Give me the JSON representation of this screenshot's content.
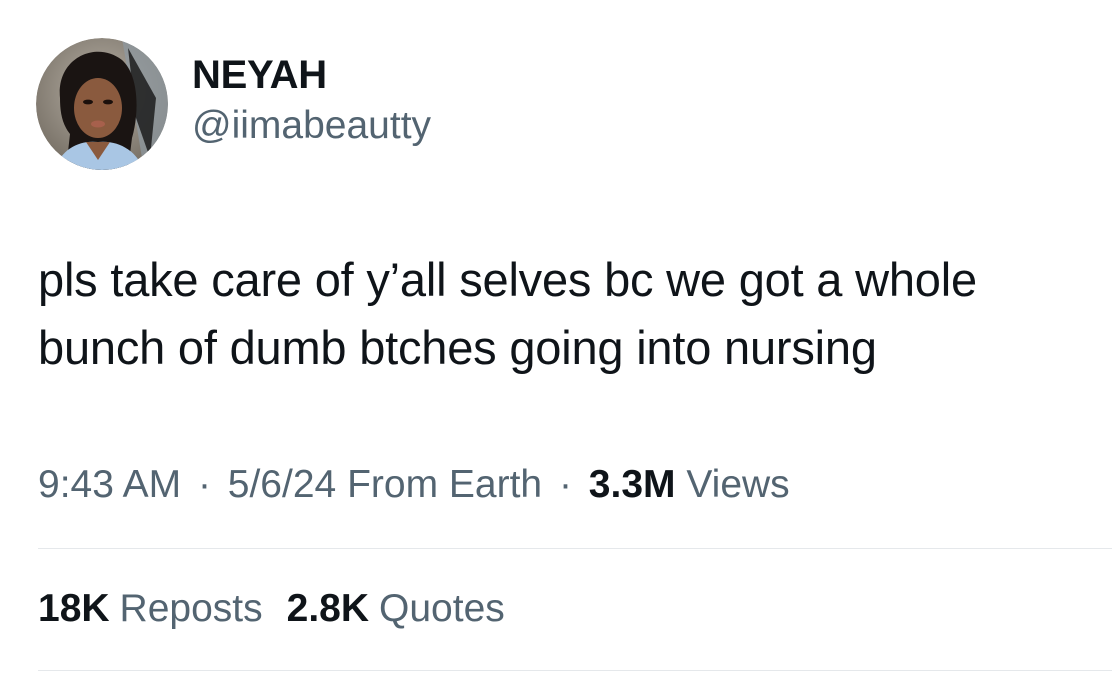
{
  "author": {
    "display_name": "NEYAH",
    "handle": "@iimabeautty"
  },
  "tweet": {
    "text": "pls take care of y’all selves bc we got a whole\nbunch of dumb btches going into nursing"
  },
  "meta": {
    "time": "9:43 AM",
    "separator": "·",
    "date": "5/6/24",
    "source": "From Earth",
    "views_count": "3.3M",
    "views_label": "Views"
  },
  "stats": {
    "reposts_count": "18K",
    "reposts_label": "Reposts",
    "quotes_count": "2.8K",
    "quotes_label": "Quotes"
  },
  "colors": {
    "text_primary": "#0f1419",
    "text_secondary": "#536471",
    "divider": "#e5e8eb"
  }
}
